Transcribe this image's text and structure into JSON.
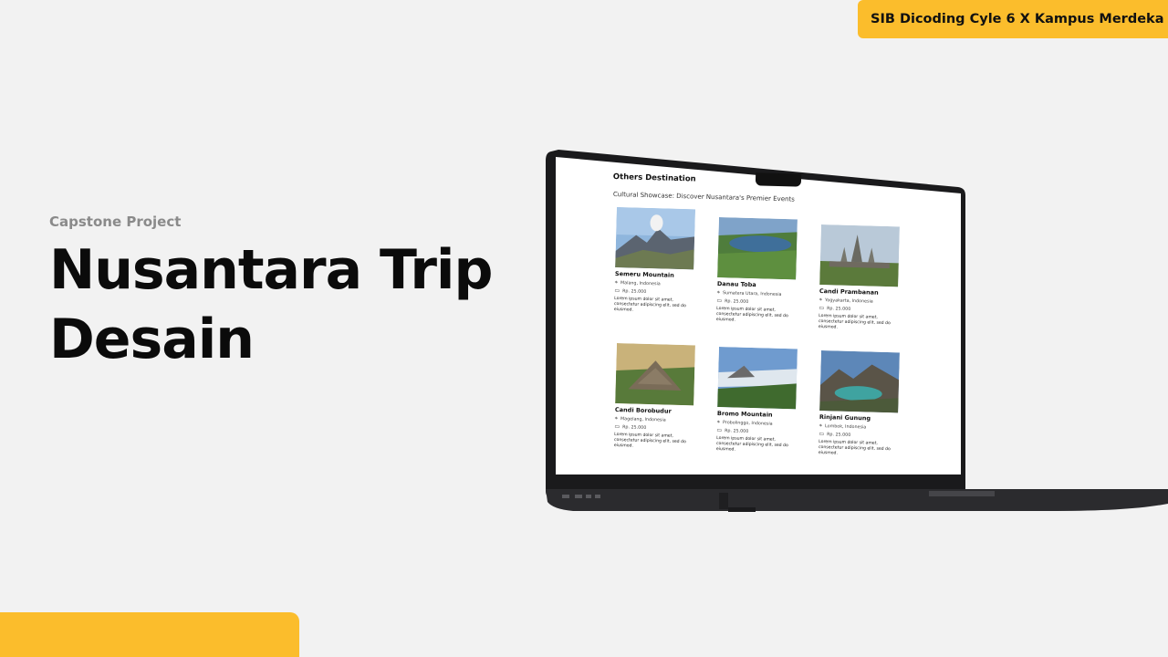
{
  "badge": {
    "label": "SIB Dicoding Cyle 6 X Kampus Merdeka"
  },
  "hero": {
    "subtitle": "Capstone Project",
    "title_line1": "Nusantara Trip",
    "title_line2": "Desain"
  },
  "screen": {
    "section_title": "Others Destination",
    "section_subtitle": "Cultural Showcase: Discover Nusantara's Premier Events",
    "cards": [
      {
        "name": "Semeru Mountain",
        "location": "Malang, Indonesia",
        "price": "Rp. 25.000",
        "description": "Lorem ipsum dolor sit amet, consectetur adipiscing elit, sed do eiusmod.",
        "icon": "location-icon"
      },
      {
        "name": "Danau Toba",
        "location": "Sumatera Utara, Indonesia",
        "price": "Rp. 25.000",
        "description": "Lorem ipsum dolor sit amet, consectetur adipiscing elit, sed do eiusmod.",
        "icon": "location-icon"
      },
      {
        "name": "Candi Prambanan",
        "location": "Yogyakarta, Indonesia",
        "price": "Rp. 25.000",
        "description": "Lorem ipsum dolor sit amet, consectetur adipiscing elit, sed do eiusmod.",
        "icon": "location-icon"
      },
      {
        "name": "Candi Borobudur",
        "location": "Magelang, Indonesia",
        "price": "Rp. 25.000",
        "description": "Lorem ipsum dolor sit amet, consectetur adipiscing elit, sed do eiusmod.",
        "icon": "location-icon"
      },
      {
        "name": "Bromo Mountain",
        "location": "Probolinggo, Indonesia",
        "price": "Rp. 25.000",
        "description": "Lorem ipsum dolor sit amet, consectetur adipiscing elit, sed do eiusmod.",
        "icon": "location-icon"
      },
      {
        "name": "Rinjani Gunung",
        "location": "Lombok, Indonesia",
        "price": "Rp. 25.000",
        "description": "Lorem ipsum dolor sit amet, consectetur adipiscing elit, sed do eiusmod.",
        "icon": "location-icon"
      }
    ]
  },
  "colors": {
    "accent": "#fbbd2c",
    "background": "#f2f2f2",
    "laptop_body": "#2b2b2e"
  }
}
